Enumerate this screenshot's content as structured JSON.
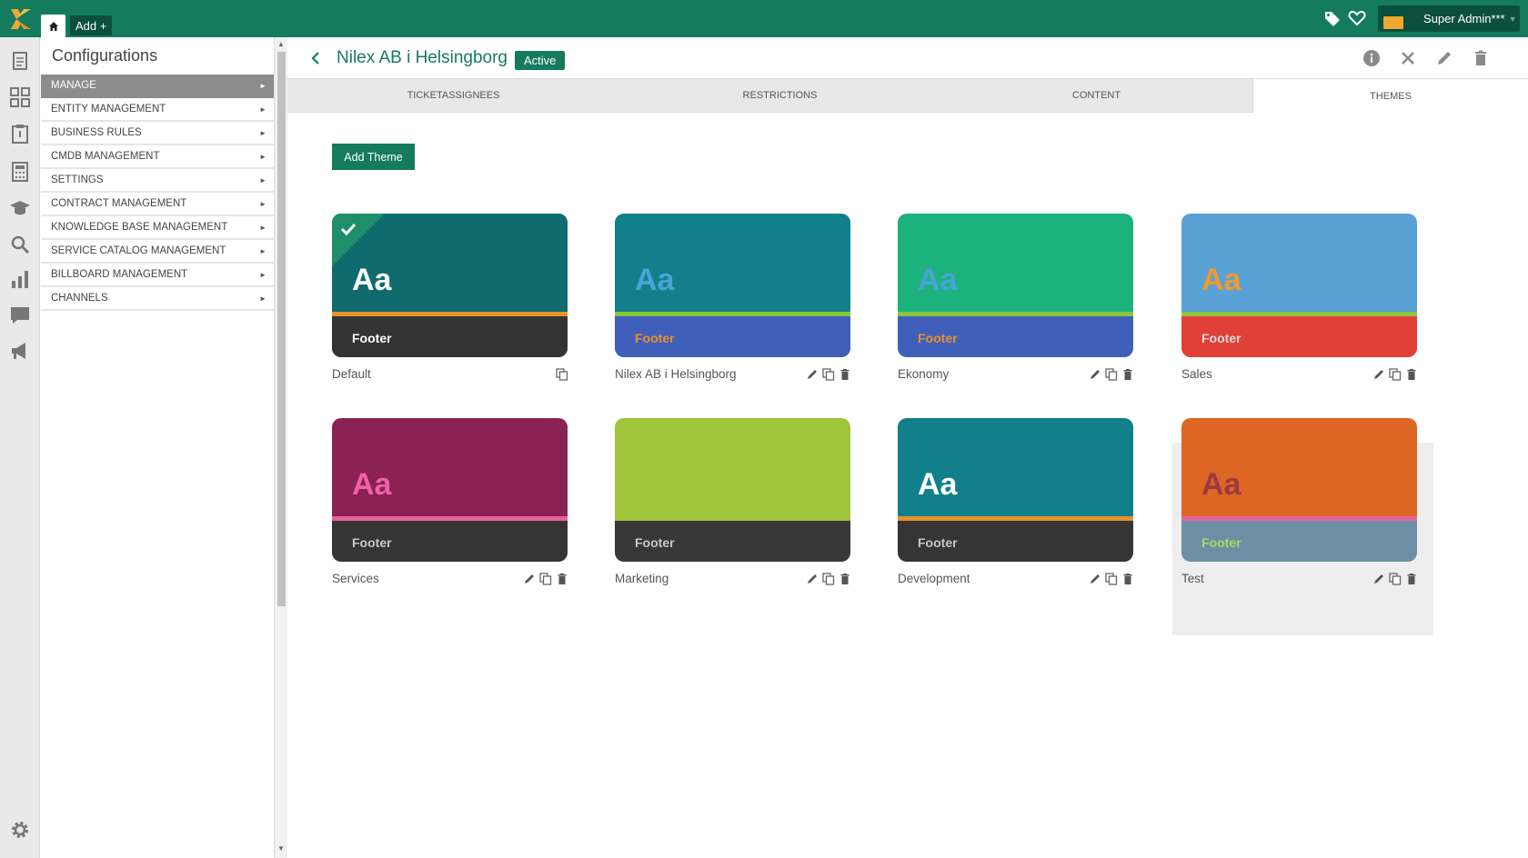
{
  "topbar": {
    "add_label": "Add +",
    "user_name": "Super Admin***"
  },
  "config": {
    "title": "Configurations",
    "menu": [
      {
        "label": "MANAGE",
        "active": true
      },
      {
        "label": "ENTITY MANAGEMENT"
      },
      {
        "label": "BUSINESS RULES"
      },
      {
        "label": "CMDB MANAGEMENT"
      },
      {
        "label": "SETTINGS"
      },
      {
        "label": "CONTRACT MANAGEMENT"
      },
      {
        "label": "KNOWLEDGE BASE MANAGEMENT"
      },
      {
        "label": "SERVICE CATALOG MANAGEMENT"
      },
      {
        "label": "BILLBOARD MANAGEMENT"
      },
      {
        "label": "CHANNELS"
      }
    ]
  },
  "main": {
    "title": "Nilex AB i Helsingborg",
    "status": "Active",
    "tabs": [
      "TICKETASSIGNEES",
      "RESTRICTIONS",
      "CONTENT",
      "THEMES"
    ],
    "add_theme_label": "Add Theme"
  },
  "themes": [
    {
      "name": "Default",
      "aa": "Aa",
      "footer": "Footer",
      "top": "#0f6b6e",
      "line": "#e8912c",
      "bottom": "#333333",
      "aa_color": "#ffffff",
      "footer_color": "#ffffff",
      "selected": true
    },
    {
      "name": "Nilex AB i Helsingborg",
      "aa": "Aa",
      "footer": "Footer",
      "top": "#11808a",
      "line": "#8cc43e",
      "bottom": "#3f5fba",
      "aa_color": "#4aa3d8",
      "footer_color": "#e8912c"
    },
    {
      "name": "Ekonomy",
      "aa": "Aa",
      "footer": "Footer",
      "top": "#1cb27e",
      "line": "#8cc43e",
      "bottom": "#3f5fba",
      "aa_color": "#4aa3d8",
      "footer_color": "#e8912c"
    },
    {
      "name": "Sales",
      "aa": "Aa",
      "footer": "Footer",
      "top": "#5aa1d6",
      "line": "#8cc43e",
      "bottom": "#e04038",
      "aa_color": "#f09a30",
      "footer_color": "#d9d9d9"
    },
    {
      "name": "Services",
      "aa": "Aa",
      "footer": "Footer",
      "top": "#8a2254",
      "line": "#e8609c",
      "bottom": "#353535",
      "aa_color": "#f060a8",
      "footer_color": "#c8c8c8"
    },
    {
      "name": "Marketing",
      "aa": "",
      "footer": "Footer",
      "top": "#a0c43a",
      "line": "#a0c43a",
      "bottom": "#383838",
      "aa_color": "#a0c43a",
      "footer_color": "#c8c8c8"
    },
    {
      "name": "Development",
      "aa": "Aa",
      "footer": "Footer",
      "top": "#11808a",
      "line": "#e8912c",
      "bottom": "#353535",
      "aa_color": "#ffffff",
      "footer_color": "#c8c8c8"
    },
    {
      "name": "Test",
      "aa": "Aa",
      "footer": "Footer",
      "top": "#dd6625",
      "line": "#e8609c",
      "bottom": "#6d8fa6",
      "aa_color": "#9a3a40",
      "footer_color": "#9fe060"
    }
  ],
  "colors": {
    "brand": "#147b5f",
    "brand_dark": "#0b4f3d"
  }
}
